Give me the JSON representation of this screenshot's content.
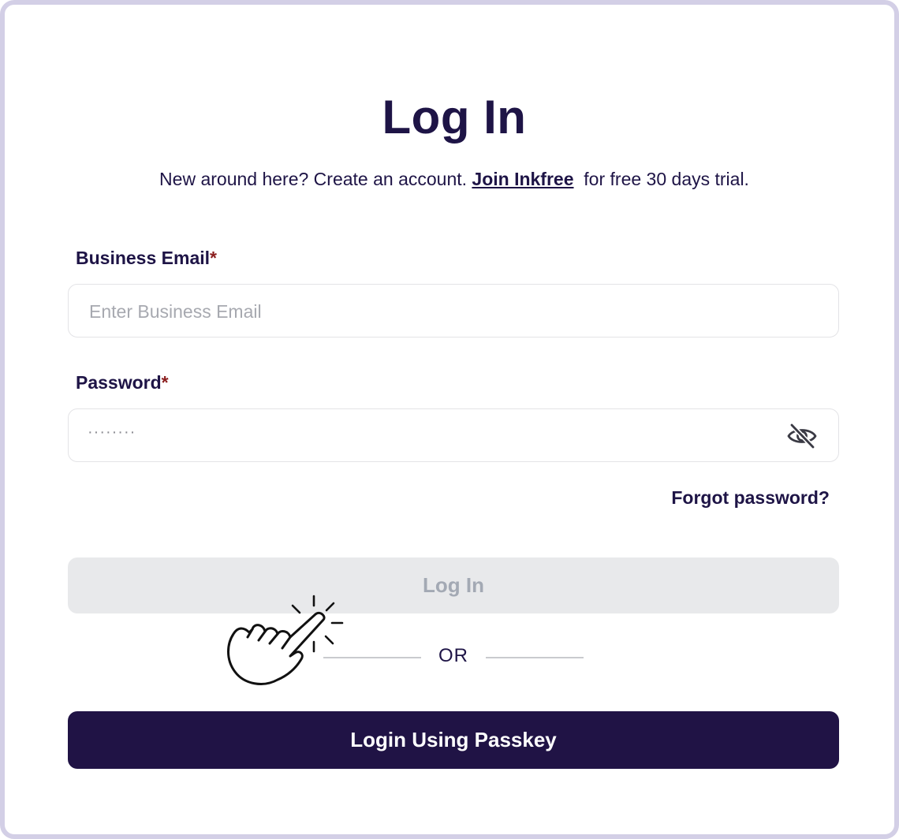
{
  "header": {
    "title": "Log In",
    "subtitle_prefix": "New around here? Create an account. ",
    "join_link": "Join Inkfree",
    "subtitle_suffix": "  for free 30 days trial."
  },
  "form": {
    "email": {
      "label": "Business Email",
      "required_mark": "*",
      "placeholder": "Enter Business Email",
      "value": ""
    },
    "password": {
      "label": "Password",
      "required_mark": "*",
      "masked_value": "········",
      "visibility_icon": "eye-off-icon"
    },
    "forgot_password": "Forgot password?",
    "login_button": "Log In",
    "divider_text": "OR",
    "passkey_button": "Login Using Passkey"
  },
  "overlay": {
    "cursor_icon": "hand-pointer-click-icon"
  },
  "colors": {
    "primary": "#201345",
    "heading": "#1e1446",
    "required": "#8b1e1e",
    "disabled_bg": "#e8e9eb",
    "disabled_text": "#a3a9b4",
    "frame_border": "#d3cfe6"
  }
}
